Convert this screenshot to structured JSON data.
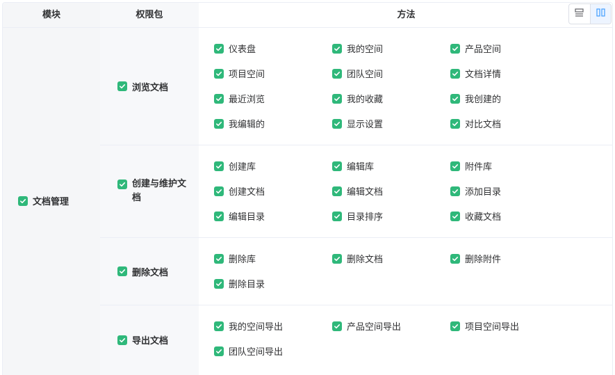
{
  "headers": {
    "module": "模块",
    "permission_pack": "权限包",
    "methods": "方法"
  },
  "view_toggle": [
    {
      "icon": "list-view-icon",
      "active": false
    },
    {
      "icon": "column-view-icon",
      "active": true
    }
  ],
  "module": {
    "label": "文档管理",
    "checked": true
  },
  "packs": [
    {
      "label": "浏览文档",
      "checked": true,
      "methods": [
        "仪表盘",
        "我的空间",
        "产品空间",
        "项目空间",
        "团队空间",
        "文档详情",
        "最近浏览",
        "我的收藏",
        "我创建的",
        "我编辑的",
        "显示设置",
        "对比文档"
      ]
    },
    {
      "label": "创建与维护文档",
      "checked": true,
      "methods": [
        "创建库",
        "编辑库",
        "附件库",
        "创建文档",
        "编辑文档",
        "添加目录",
        "编辑目录",
        "目录排序",
        "收藏文档"
      ]
    },
    {
      "label": "删除文档",
      "checked": true,
      "methods": [
        "删除库",
        "删除文档",
        "删除附件",
        "删除目录"
      ]
    },
    {
      "label": "导出文档",
      "checked": true,
      "methods": [
        "我的空间导出",
        "产品空间导出",
        "项目空间导出",
        "团队空间导出"
      ]
    }
  ],
  "colors": {
    "check": "#2fb87a",
    "border": "#ebeef5",
    "accent": "#409eff"
  }
}
